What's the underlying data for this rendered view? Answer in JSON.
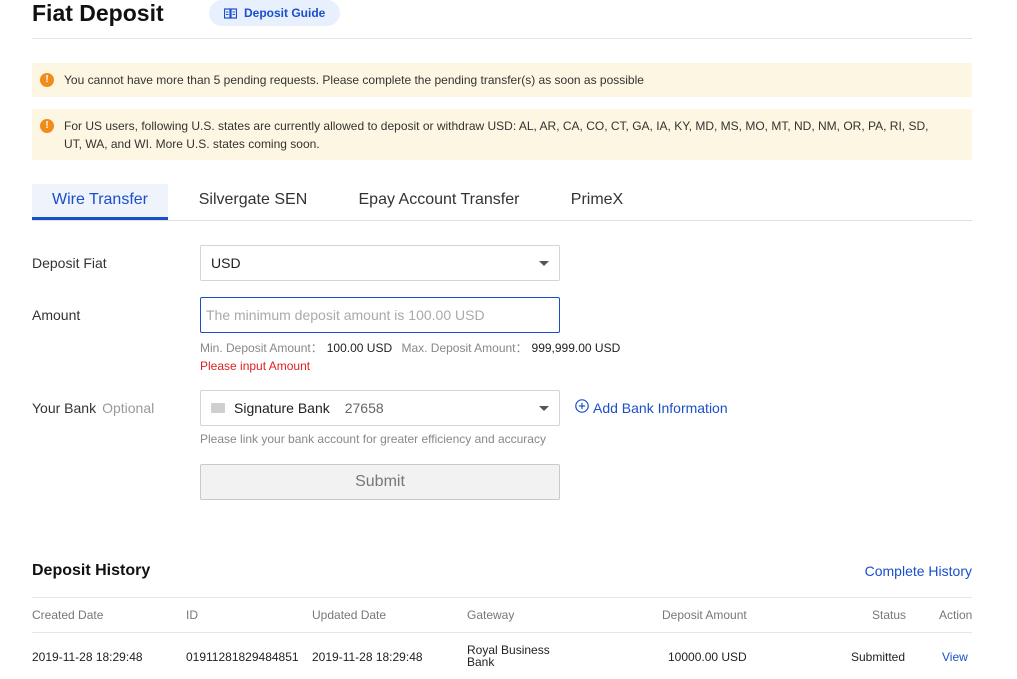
{
  "header": {
    "title": "Fiat Deposit",
    "guide_button": "Deposit Guide"
  },
  "alerts": [
    "You cannot have more than 5 pending requests. Please complete the pending transfer(s) as soon as possible",
    "For US users, following U.S. states are currently allowed to deposit or withdraw USD: AL, AR, CA, CO, CT, GA, IA, KY, MD, MS, MO, MT, ND, NM, OR, PA, RI, SD, UT, WA, and WI. More U.S. states coming soon."
  ],
  "tabs": [
    {
      "label": "Wire Transfer",
      "active": true
    },
    {
      "label": "Silvergate SEN",
      "active": false
    },
    {
      "label": "Epay Account Transfer",
      "active": false
    },
    {
      "label": "PrimeX",
      "active": false
    }
  ],
  "form": {
    "deposit_fiat": {
      "label": "Deposit Fiat",
      "value": "USD"
    },
    "amount": {
      "label": "Amount",
      "value": "",
      "placeholder": "The minimum deposit amount is 100.00 USD",
      "min_label": "Min. Deposit Amount：",
      "min_value": "100.00 USD",
      "max_label": "Max. Deposit Amount：",
      "max_value": "999,999.00 USD",
      "error": "Please input Amount"
    },
    "bank": {
      "label": "Your Bank",
      "optional": "Optional",
      "name": "Signature Bank",
      "number": "27658",
      "add_link": "Add Bank Information",
      "hint": "Please link your bank account for greater efficiency and accuracy"
    },
    "submit": "Submit"
  },
  "history": {
    "title": "Deposit History",
    "complete_link": "Complete History",
    "columns": [
      "Created Date",
      "ID",
      "Updated Date",
      "Gateway",
      "Deposit Amount",
      "Status",
      "Action"
    ],
    "rows": [
      {
        "created": "2019-11-28 18:29:48",
        "id": "01911281829484851",
        "updated": "2019-11-28 18:29:48",
        "gateway": "Royal Business Bank",
        "amount": "10000.00 USD",
        "status": "Submitted",
        "action": "View"
      }
    ]
  },
  "colors": {
    "accent": "#1a4fc9",
    "warning": "#f08c1a",
    "alert_bg": "#fdf6e2",
    "error": "#e02020"
  }
}
